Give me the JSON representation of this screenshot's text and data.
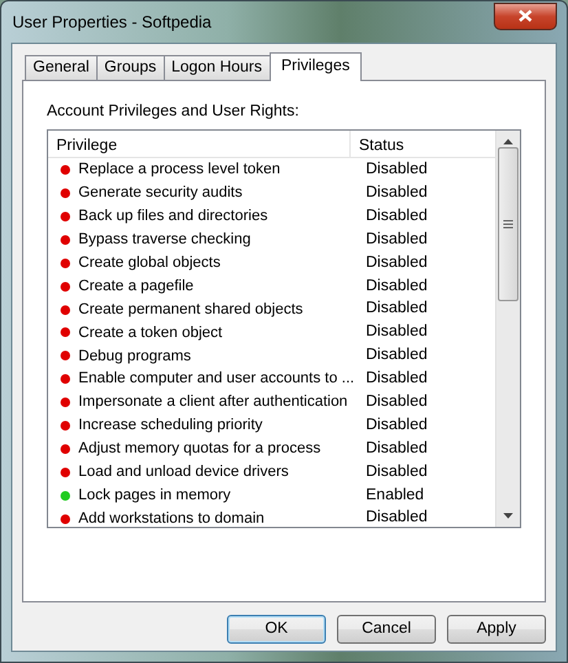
{
  "window": {
    "title": "User Properties - Softpedia"
  },
  "tabs": [
    {
      "label": "General",
      "selected": false
    },
    {
      "label": "Groups",
      "selected": false
    },
    {
      "label": "Logon Hours",
      "selected": false
    },
    {
      "label": "Privileges",
      "selected": true
    }
  ],
  "section_label": "Account Privileges and User Rights:",
  "table": {
    "columns": [
      "Privilege",
      "Status"
    ],
    "rows": [
      {
        "privilege": "Replace a process level token",
        "status": "Disabled",
        "color": "#e00000"
      },
      {
        "privilege": "Generate security audits",
        "status": "Disabled",
        "color": "#e00000"
      },
      {
        "privilege": "Back up files and directories",
        "status": "Disabled",
        "color": "#e00000"
      },
      {
        "privilege": "Bypass traverse checking",
        "status": "Disabled",
        "color": "#e00000"
      },
      {
        "privilege": "Create global objects",
        "status": "Disabled",
        "color": "#e00000"
      },
      {
        "privilege": "Create a pagefile",
        "status": "Disabled",
        "color": "#e00000"
      },
      {
        "privilege": "Create permanent shared objects",
        "status": "Disabled",
        "color": "#e00000"
      },
      {
        "privilege": "Create a token object",
        "status": "Disabled",
        "color": "#e00000"
      },
      {
        "privilege": "Debug programs",
        "status": "Disabled",
        "color": "#e00000"
      },
      {
        "privilege": "Enable computer and user accounts to ...",
        "status": "Disabled",
        "color": "#e00000"
      },
      {
        "privilege": "Impersonate a client after authentication",
        "status": "Disabled",
        "color": "#e00000"
      },
      {
        "privilege": "Increase scheduling priority",
        "status": "Disabled",
        "color": "#e00000"
      },
      {
        "privilege": "Adjust memory quotas for a process",
        "status": "Disabled",
        "color": "#e00000"
      },
      {
        "privilege": "Load and unload device drivers",
        "status": "Disabled",
        "color": "#e00000"
      },
      {
        "privilege": "Lock pages in memory",
        "status": "Enabled",
        "color": "#22cc22"
      },
      {
        "privilege": "Add workstations to domain",
        "status": "Disabled",
        "color": "#e00000"
      }
    ]
  },
  "buttons": [
    {
      "label": "OK",
      "default": true
    },
    {
      "label": "Cancel",
      "default": false
    },
    {
      "label": "Apply",
      "default": false
    }
  ]
}
